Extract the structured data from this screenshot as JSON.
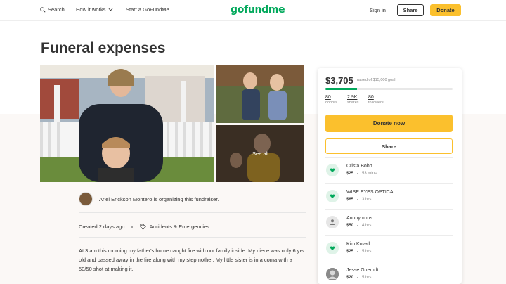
{
  "nav": {
    "search": "Search",
    "how_it_works": "How it works",
    "start": "Start a GoFundMe",
    "logo": "gofundme",
    "sign_in": "Sign in",
    "share": "Share",
    "donate": "Donate"
  },
  "campaign": {
    "title": "Funeral expenses",
    "see_all": "See all",
    "organizer": "Ariel Erickson Montero is organizing this fundraiser.",
    "created": "Created 2 days ago",
    "category": "Accidents & Emergencies",
    "story": "At 3 am this morning my father's home caught fire with our family inside. My niece was only 6 yrs old and passed away in the fire along with my stepmother. My little sister is in a coma with a 50/50 shot at making it."
  },
  "panel": {
    "amount": "$3,705",
    "raised_text": "raised of $15,000 goal",
    "progress_fraction": 0.247,
    "stats": [
      {
        "num": "80",
        "label": "donors"
      },
      {
        "num": "2.9K",
        "label": "shares"
      },
      {
        "num": "80",
        "label": "followers"
      }
    ],
    "donate_now": "Donate now",
    "share": "Share"
  },
  "donors": [
    {
      "name": "Crista Bobb",
      "amount": "$25",
      "time": "53 mins",
      "icon": "heart-hand-icon"
    },
    {
      "name": "WISE EYES OPTICAL",
      "amount": "$65",
      "time": "3 hrs",
      "icon": "heart-hand-icon"
    },
    {
      "name": "Anonymous",
      "amount": "$50",
      "time": "4 hrs",
      "icon": "user-icon"
    },
    {
      "name": "Kim Kovall",
      "amount": "$25",
      "time": "5 hrs",
      "icon": "heart-hand-icon"
    },
    {
      "name": "Jesse Guerndt",
      "amount": "$20",
      "time": "5 hrs",
      "icon": "photo-avatar"
    }
  ],
  "colors": {
    "brand_green": "#02a95c",
    "donate_yellow": "#fbc02d"
  }
}
